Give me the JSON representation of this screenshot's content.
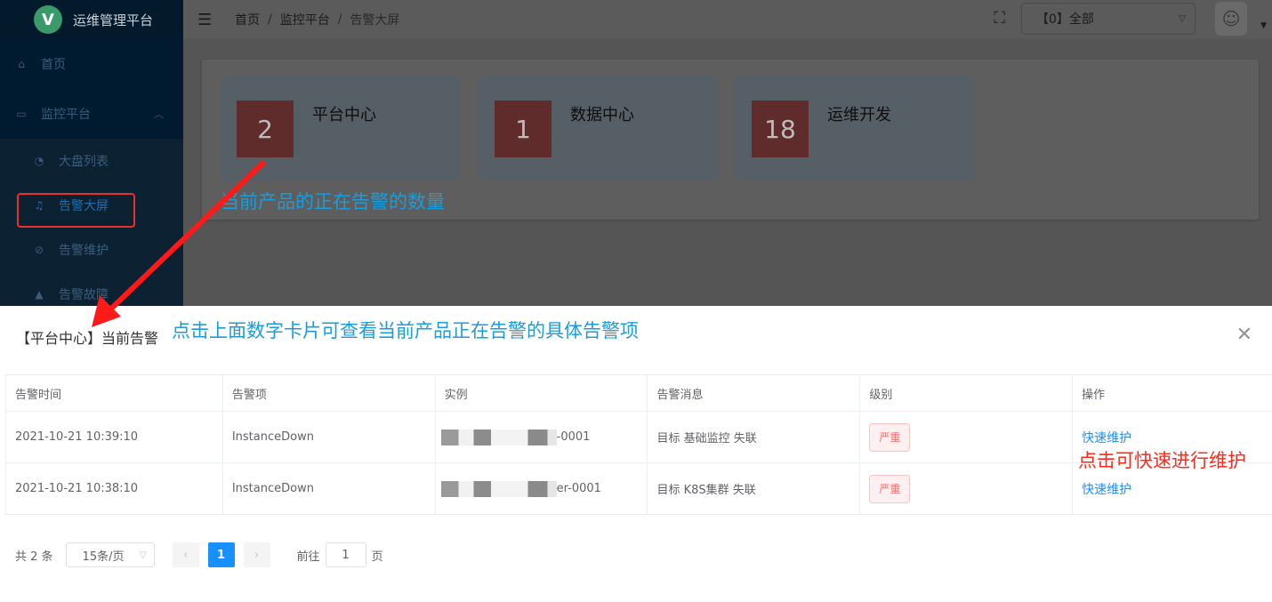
{
  "app": {
    "logo_letter": "V",
    "title": "运维管理平台"
  },
  "sidebar": {
    "items": [
      {
        "label": "首页",
        "icon": "home-icon"
      },
      {
        "label": "监控平台",
        "icon": "monitor-icon"
      }
    ],
    "subitems": [
      {
        "label": "大盘列表",
        "icon": "dashboard-icon"
      },
      {
        "label": "告警大屏",
        "icon": "bell-icon",
        "active": true
      },
      {
        "label": "告警维护",
        "icon": "maintenance-icon"
      },
      {
        "label": "告警故障",
        "icon": "warning-icon"
      }
    ]
  },
  "header": {
    "breadcrumb": [
      "首页",
      "监控平台",
      "告警大屏"
    ],
    "select_value": "【0】全部"
  },
  "cards": [
    {
      "count": "2",
      "title": "平台中心"
    },
    {
      "count": "1",
      "title": "数据中心"
    },
    {
      "count": "18",
      "title": "运维开发"
    }
  ],
  "annotations": {
    "cards_note": "当前产品的正在告警的数量",
    "dialog_note": "点击上面数字卡片可查看当前产品正在告警的具体告警项",
    "action_note": "点击可快速进行维护"
  },
  "dialog": {
    "title": "【平台中心】当前告警",
    "columns": [
      "告警时间",
      "告警项",
      "实例",
      "告警消息",
      "级别",
      "操作"
    ],
    "rows": [
      {
        "time": "2021-10-21 10:39:10",
        "item": "InstanceDown",
        "instance_suffix": "-0001",
        "message": "目标 基础监控 失联",
        "level": "严重",
        "action": "快速维护"
      },
      {
        "time": "2021-10-21 10:38:10",
        "item": "InstanceDown",
        "instance_suffix": "er-0001",
        "message": "目标 K8S集群 失联",
        "level": "严重",
        "action": "快速维护"
      }
    ]
  },
  "pagination": {
    "total": "共 2 条",
    "page_size": "15条/页",
    "current_page": "1",
    "goto_label": "前往",
    "goto_value": "1",
    "page_unit": "页"
  }
}
